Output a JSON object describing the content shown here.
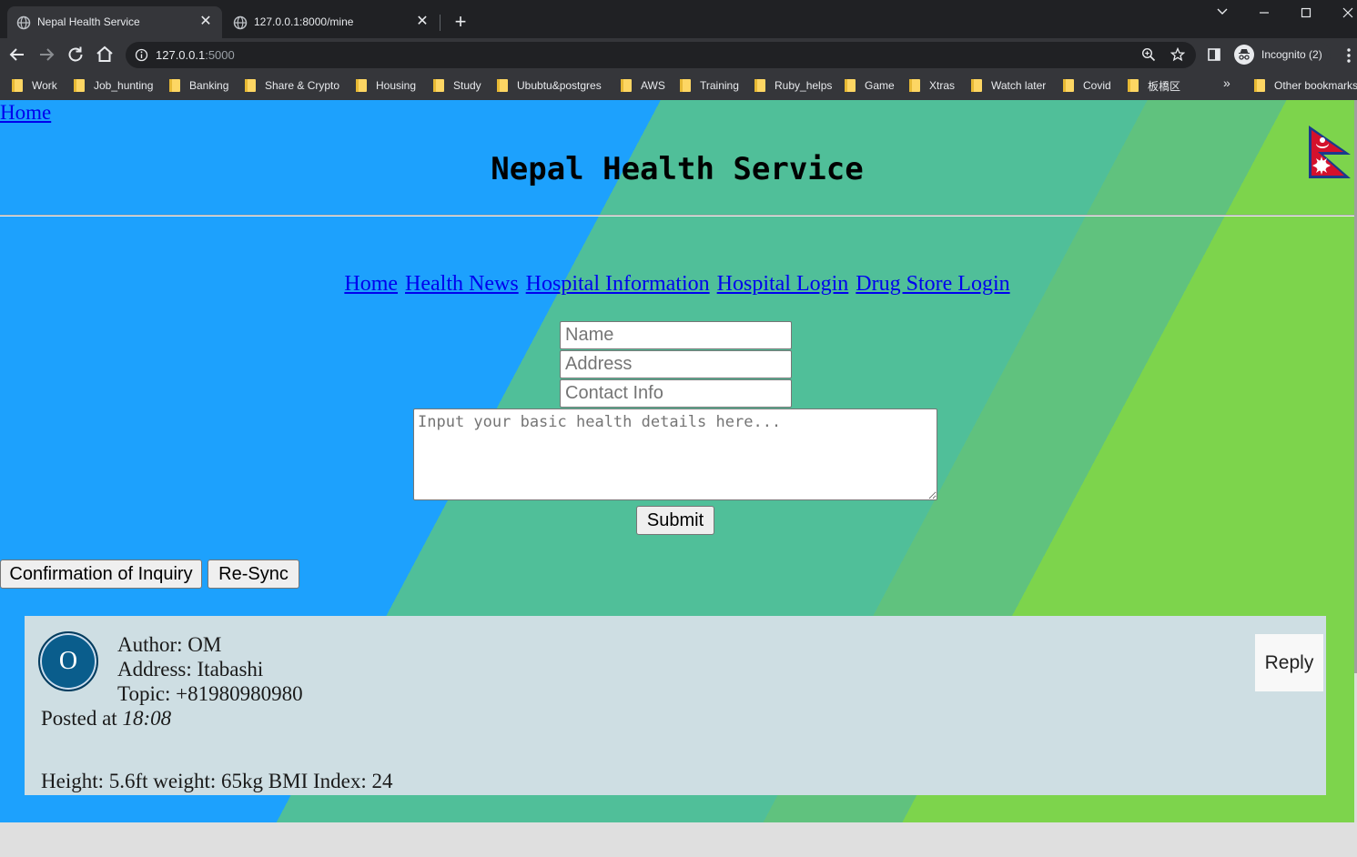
{
  "browser": {
    "tabs": [
      {
        "title": "Nepal Health Service",
        "active": true
      },
      {
        "title": "127.0.0.1:8000/mine",
        "active": false
      }
    ],
    "url_host": "127.0.0.1",
    "url_port": ":5000",
    "profile_label": "Incognito (2)",
    "bookmarks": [
      "Work",
      "Job_hunting",
      "Banking",
      "Share & Crypto",
      "Housing",
      "Study",
      "Ububtu&postgres",
      "AWS",
      "Training",
      "Ruby_helps",
      "Game",
      "Xtras",
      "Watch later",
      "Covid",
      "板橋区"
    ],
    "bookmarks_more": "»",
    "other_bookmarks": "Other bookmarks"
  },
  "page": {
    "home_link": "Home",
    "title": "Nepal Health Service",
    "nav": [
      "Home",
      "Health News",
      "Hospital Information",
      "Hospital Login",
      "Drug Store Login"
    ],
    "form": {
      "name_placeholder": "Name",
      "address_placeholder": "Address",
      "contact_placeholder": "Contact Info",
      "details_placeholder": "Input your basic health details here...",
      "submit_label": "Submit"
    },
    "actions": {
      "confirm_label": "Confirmation of Inquiry",
      "resync_label": "Re-Sync"
    },
    "post": {
      "avatar_initial": "O",
      "author": "Author: OM",
      "address": "Address: Itabashi",
      "topic": "Topic: +81980980980",
      "posted_prefix": "Posted at",
      "posted_time": "18:08",
      "body": "Height: 5.6ft weight: 65kg BMI Index: 24",
      "reply_label": "Reply"
    }
  },
  "colors": {
    "blue_band": "#1da1fd",
    "teal_band": "#50bf99",
    "green_band": "#7dd44c",
    "post_bg": "#cedee3",
    "avatar_bg": "#0a5d8c"
  }
}
